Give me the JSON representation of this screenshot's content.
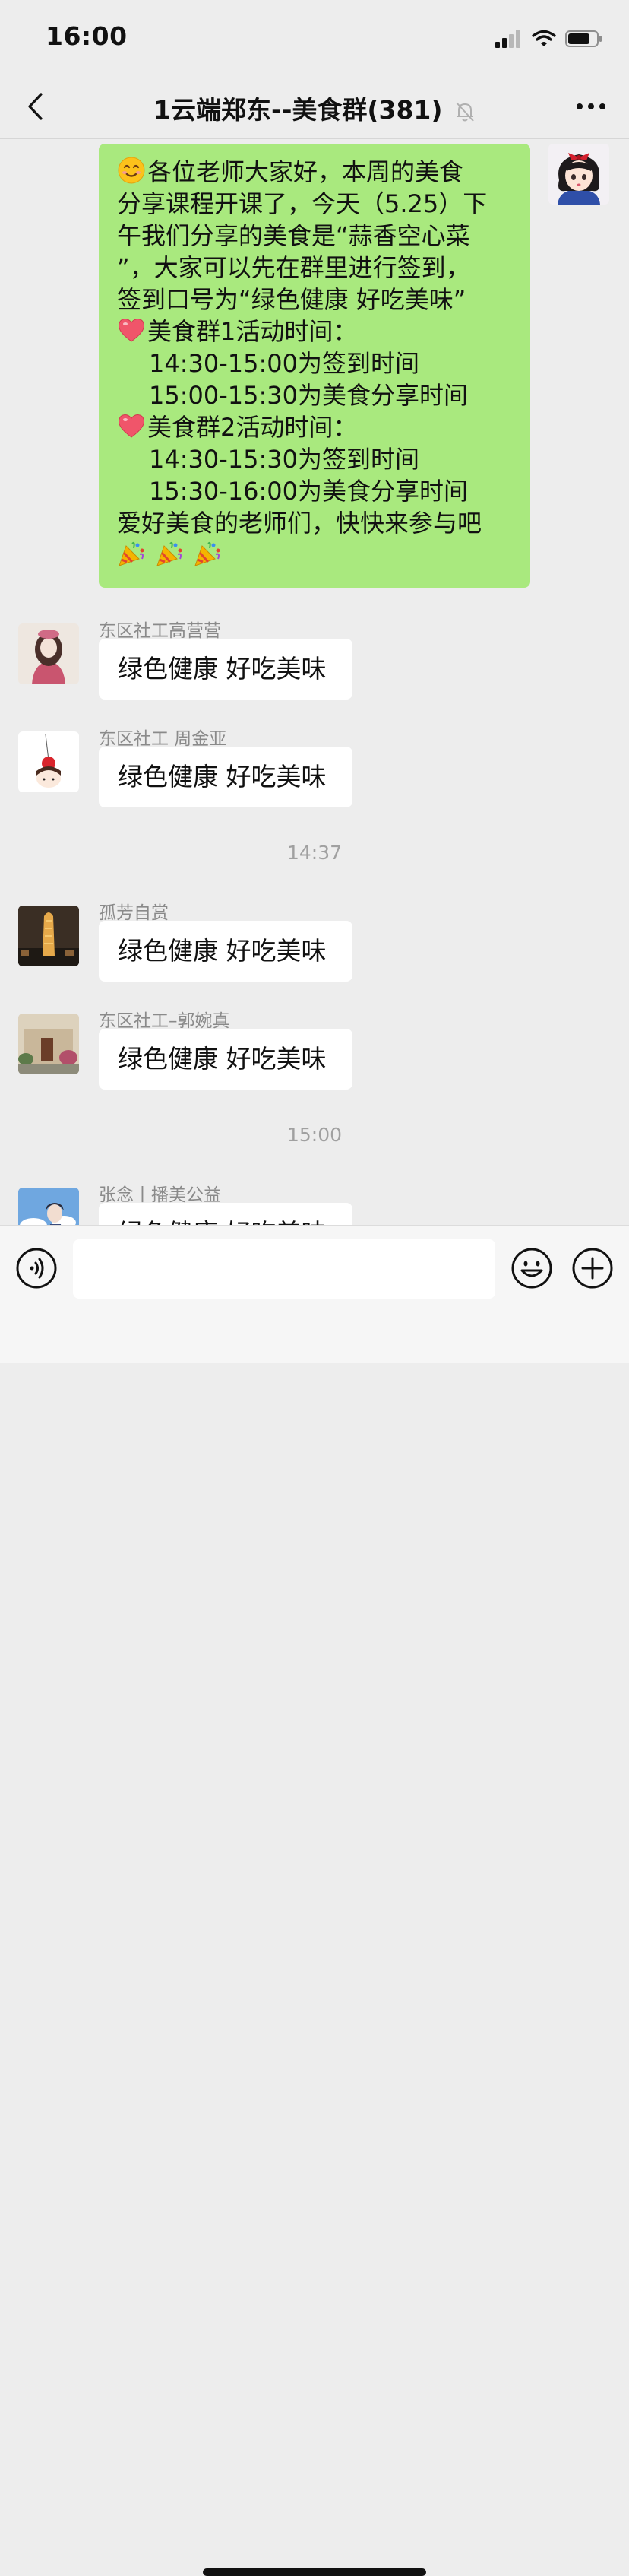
{
  "status_bar": {
    "time": "16:00"
  },
  "header": {
    "title": "1云端郑东--美食群(381)"
  },
  "chat": {
    "outgoing": {
      "lines": [
        "各位老师大家好，本周的美食",
        "分享课程开课了，今天（5.25）下",
        "午我们分享的美食是“蒜香空心菜",
        "”，大家可以先在群里进行签到，",
        "签到口号为“绿色健康 好吃美味”",
        "美食群1活动时间：",
        "14:30-15:00为签到时间",
        "15:00-15:30为美食分享时间",
        "美食群2活动时间：",
        "14:30-15:30为签到时间",
        "15:30-16:00为美食分享时间",
        "爱好美食的老师们，快快来参与吧"
      ]
    },
    "messages": [
      {
        "sender": "东区社工高营营",
        "text": "绿色健康 好吃美味"
      },
      {
        "sender": "东区社工 周金亚",
        "text": "绿色健康 好吃美味"
      },
      {
        "sender": "孤芳自赏",
        "text": "绿色健康 好吃美味"
      },
      {
        "sender": "东区社工–郭婉真",
        "text": "绿色健康 好吃美味"
      },
      {
        "sender": "张念丨播美公益",
        "text": "绿色健康 好吃美味"
      }
    ],
    "timestamps": [
      "14:37",
      "15:00"
    ]
  },
  "icons": {
    "back": "chevron-left-icon",
    "mute": "bell-muted-icon",
    "more": "more-dots-icon",
    "voice": "voice-icon",
    "emoji": "smiley-icon",
    "plus": "plus-circle-icon",
    "smile_emoji": "smiling-face-emoji",
    "heart_emoji": "red-heart-emoji",
    "party_emoji": "party-popper-emoji"
  },
  "colors": {
    "outgoing_bubble": "#a9e97e",
    "background": "#ededed",
    "incoming_bubble": "#ffffff"
  }
}
